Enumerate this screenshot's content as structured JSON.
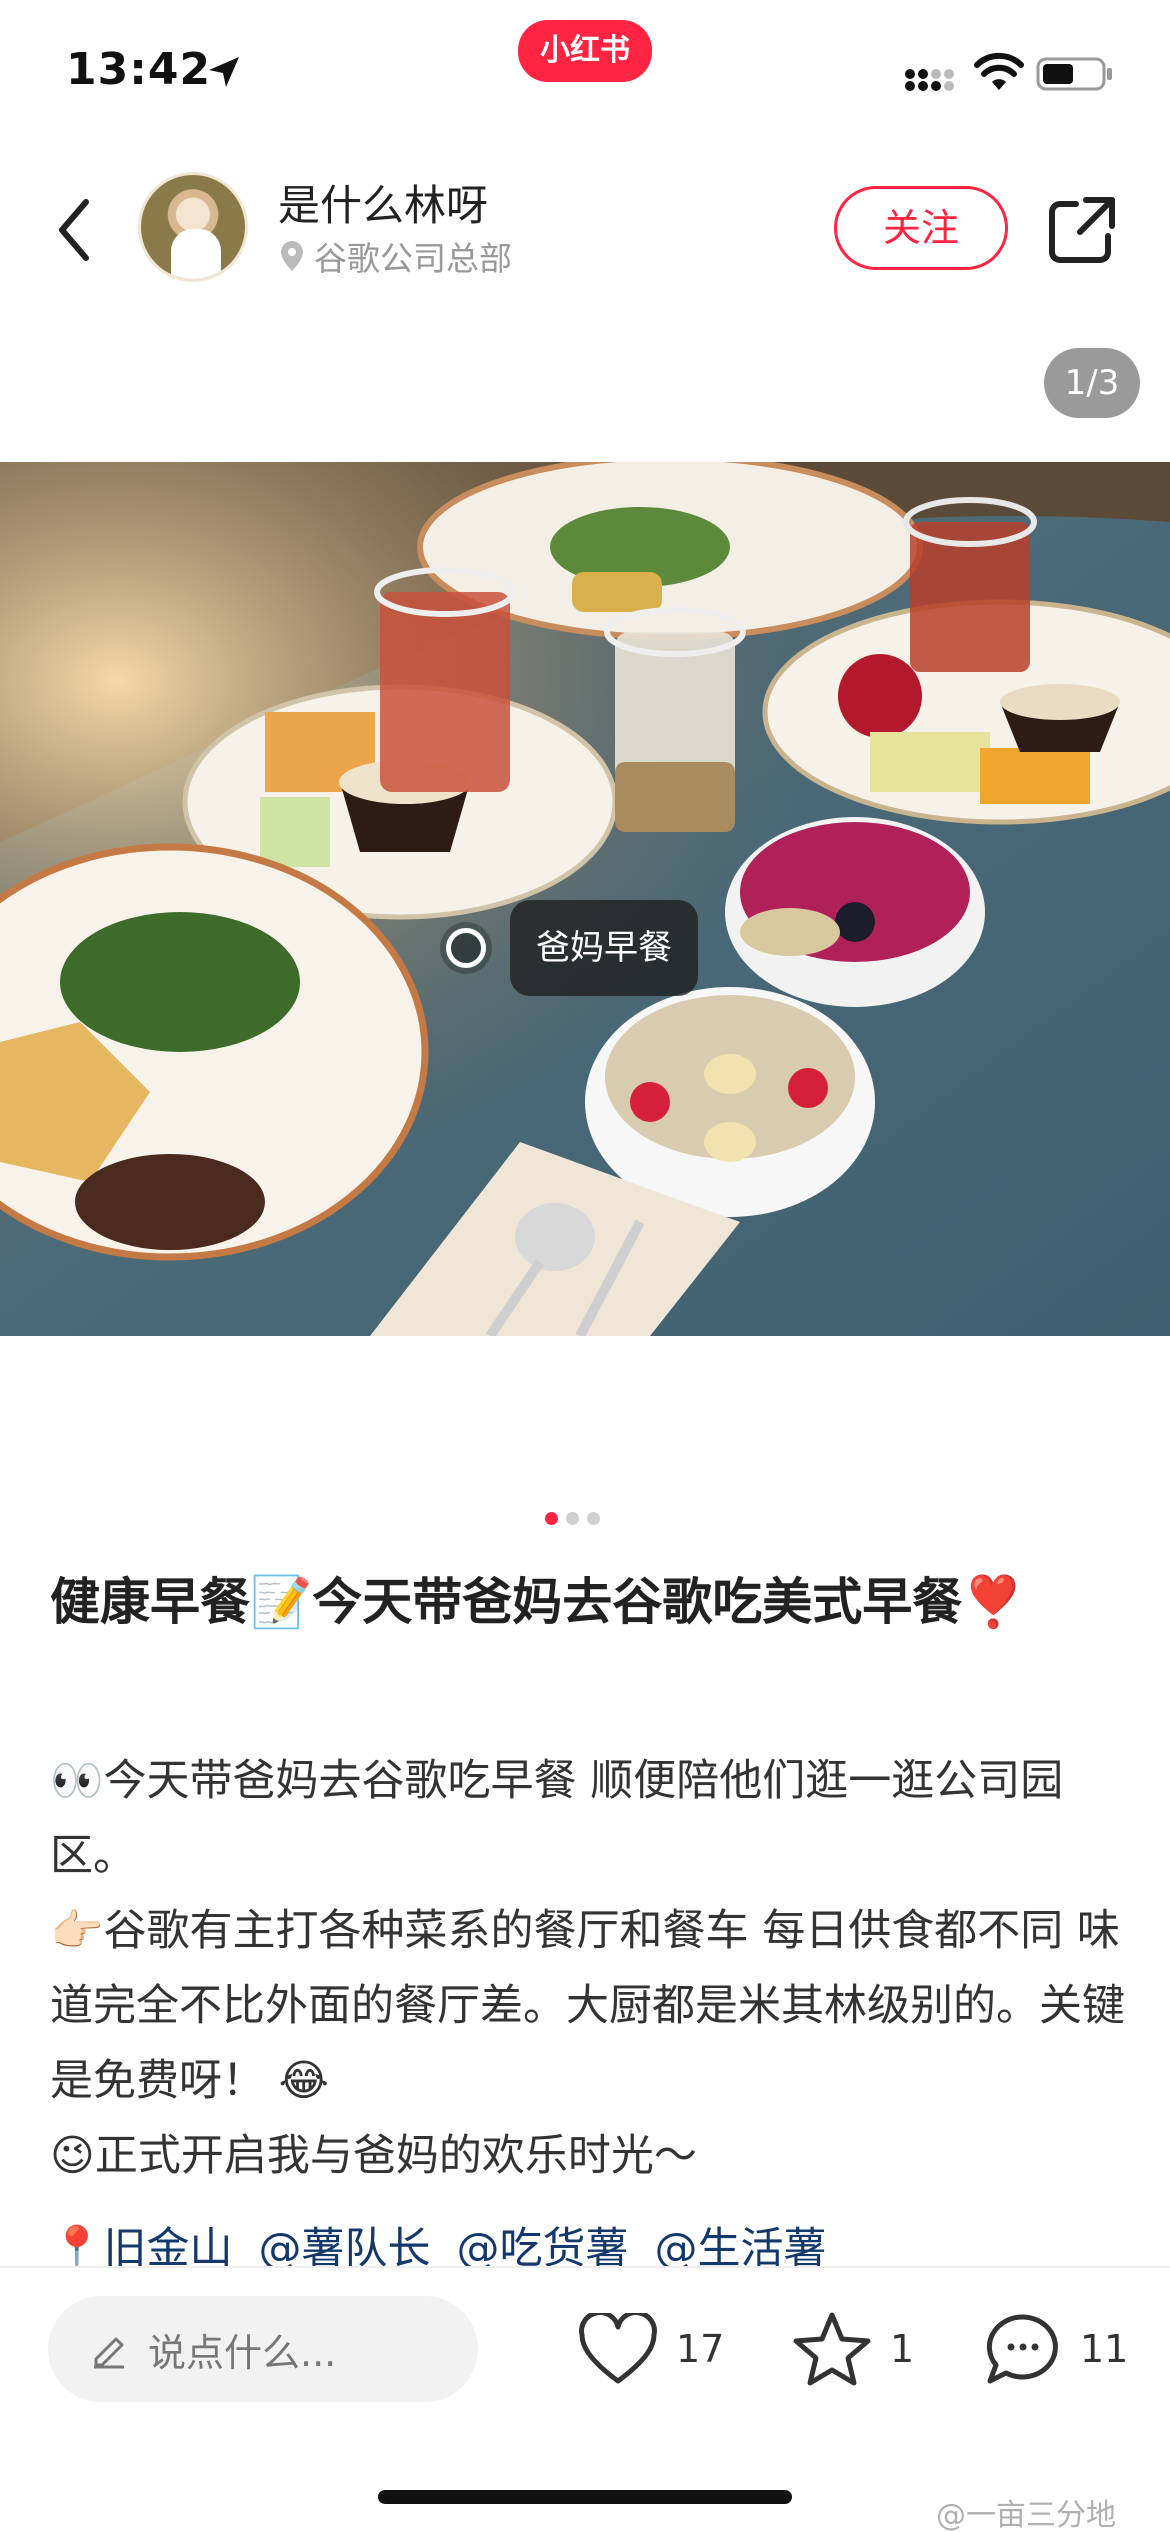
{
  "status_bar": {
    "time": "13:42",
    "app_badge": "小红书"
  },
  "header": {
    "author_name": "是什么林呀",
    "location": "谷歌公司总部",
    "follow_label": "关注"
  },
  "gallery": {
    "counter": "1/3",
    "current_index": 1,
    "total": 3,
    "photo_tag": "爸妈早餐"
  },
  "post": {
    "title": "健康早餐📝今天带爸妈去谷歌吃美式早餐❣️",
    "paragraphs": [
      "👀今天带爸妈去谷歌吃早餐 顺便陪他们逛一逛公司园区。",
      "👉🏻谷歌有主打各种菜系的餐厅和餐车 每日供食都不同 味道完全不比外面的餐厅差。大厨都是米其林级别的。关键是免费呀！ 😂",
      "😉正式开启我与爸妈的欢乐时光～"
    ],
    "tags": [
      "📍旧金山",
      "@薯队长",
      "@吃货薯",
      "@生活薯"
    ]
  },
  "bottom_bar": {
    "comment_placeholder": "说点什么...",
    "likes": "17",
    "collects": "1",
    "comments": "11"
  },
  "watermark": "@一亩三分地",
  "colors": {
    "brand_red": "#ff2442",
    "tag_blue": "#13386c"
  },
  "icons": [
    "location-arrow-icon",
    "signal-icon",
    "wifi-icon",
    "battery-icon",
    "back-chevron-icon",
    "location-pin-icon",
    "share-icon",
    "pen-icon",
    "heart-icon",
    "star-icon",
    "comment-bubble-icon"
  ]
}
